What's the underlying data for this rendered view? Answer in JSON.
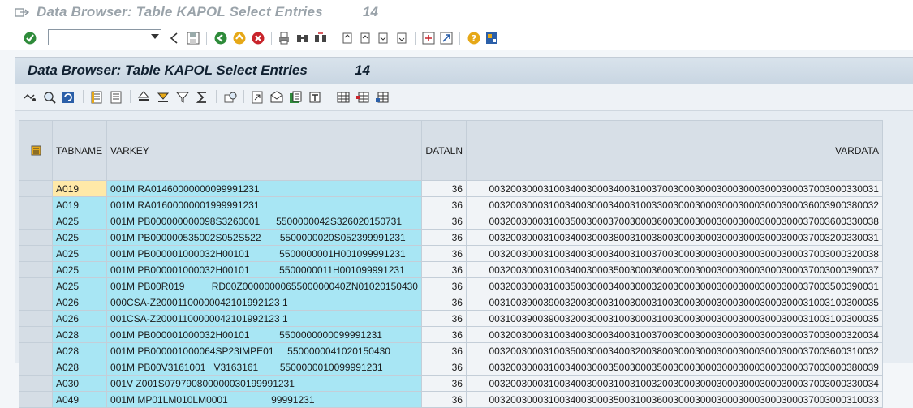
{
  "window": {
    "title": "Data Browser: Table KAPOL Select Entries",
    "count": "14"
  },
  "std_toolbar": {
    "command_value": "",
    "command_placeholder": ""
  },
  "app": {
    "title": "Data Browser: Table KAPOL Select Entries",
    "count": "14"
  },
  "table": {
    "columns": [
      "TABNAME",
      "VARKEY",
      "DATALN",
      "VARDATA"
    ],
    "rows": [
      {
        "tabname": "A019",
        "varkey": "001M RA01460000000099991231",
        "dataln": "36",
        "vardata": "003200300031003400300034003100370030003000300030003000300037003000330031"
      },
      {
        "tabname": "A019",
        "varkey": "001M RA01600000001999991231",
        "dataln": "36",
        "vardata": "003200300031003400300034003100330030003000300030003000300036003900380032"
      },
      {
        "tabname": "A025",
        "varkey": "001M PB000000000098S3260001      5500000042S326020150731",
        "dataln": "36",
        "vardata": "003200300031003500300037003000360030003000300030003000300037003600330038"
      },
      {
        "tabname": "A025",
        "varkey": "001M PB000000535002S052S522       5500000020S052399991231",
        "dataln": "36",
        "vardata": "003200300031003400300038003100380030003000300030003000300037003200330031"
      },
      {
        "tabname": "A025",
        "varkey": "001M PB000001000032H00101           5500000001H001099991231",
        "dataln": "36",
        "vardata": "003200300031003400300034003100370030003000300030003000300037003000320038"
      },
      {
        "tabname": "A025",
        "varkey": "001M PB000001000032H00101           5500000011H001099991231",
        "dataln": "36",
        "vardata": "003200300031003400300035003000360030003000300030003000300037003000390037"
      },
      {
        "tabname": "A025",
        "varkey": "001M PB00R019          RD00Z0000000065500000040ZN01020150430",
        "dataln": "36",
        "vardata": "003200300031003500300034003000320030003000300030003000300037003500390031"
      },
      {
        "tabname": "A026",
        "varkey": "000CSA-Z20001100000042101992123 1",
        "dataln": "36",
        "vardata": "003100390039003200300031003000310030003000300030003000300031003100300035"
      },
      {
        "tabname": "A026",
        "varkey": "001CSA-Z20001100000042101992123 1",
        "dataln": "36",
        "vardata": "003100390039003200300031003000310030003000300030003000300031003100300035"
      },
      {
        "tabname": "A028",
        "varkey": "001M PB000001000032H00101           5500000000099991231",
        "dataln": "36",
        "vardata": "003200300031003400300034003100370030003000300030003000300037003000320034"
      },
      {
        "tabname": "A028",
        "varkey": "001M PB000001000064SP23IMPE01     5500000041020150430",
        "dataln": "36",
        "vardata": "003200300031003500300034003200380030003000300030003000300037003600310032"
      },
      {
        "tabname": "A028",
        "varkey": "001M PB00V3161001   V3163161        5500000010099991231",
        "dataln": "36",
        "vardata": "003200300031003400300035003000350030003000300030003000300037003000380039"
      },
      {
        "tabname": "A030",
        "varkey": "001V Z001S079790800000030199991231",
        "dataln": "36",
        "vardata": "003200300031003400300031003100320030003000300030003000300037003000330034"
      },
      {
        "tabname": "A049",
        "varkey": "001M MP01LM010LM0001                99991231",
        "dataln": "36",
        "vardata": "003200300031003400300035003100360030003000300030003000300037003000310033"
      }
    ]
  },
  "colors": {
    "key_cell": "#a8e6f4",
    "focus_cell": "#ffe9a8",
    "header_bg": "#c9d6e2"
  }
}
